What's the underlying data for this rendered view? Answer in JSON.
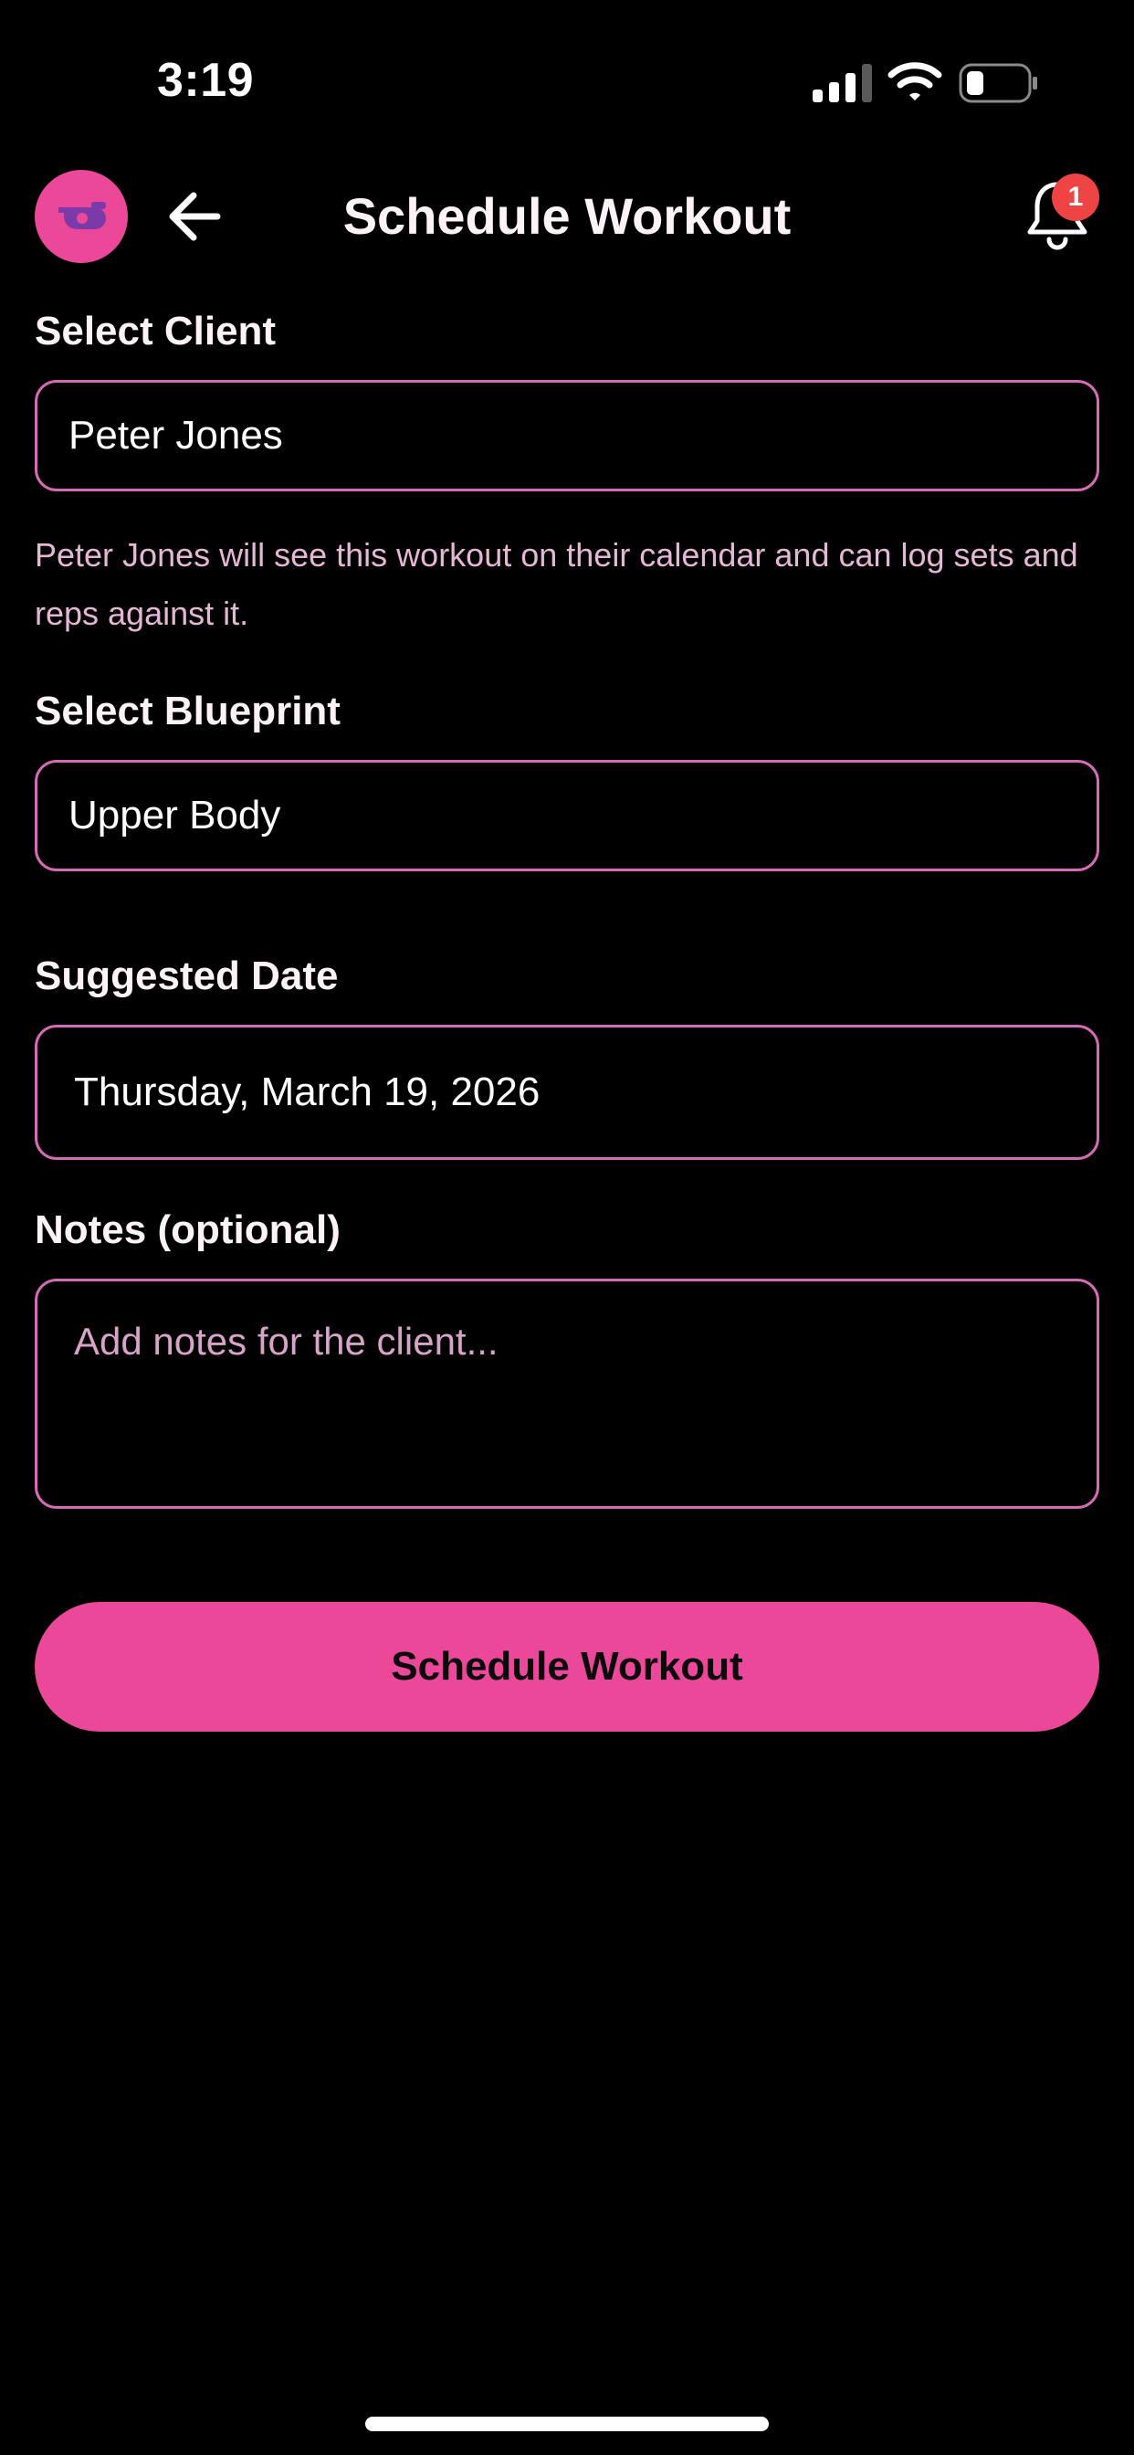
{
  "status_bar": {
    "time": "3:19",
    "icons": [
      "signal-icon",
      "wifi-icon",
      "battery-icon"
    ]
  },
  "header": {
    "logo_icon": "whistle-icon",
    "back_icon": "arrow-left-icon",
    "title": "Schedule Workout",
    "notification_icon": "bell-icon",
    "notification_count": "1"
  },
  "form": {
    "client": {
      "label": "Select Client",
      "value": "Peter Jones",
      "helper": "Peter Jones will see this workout on their calendar and can log sets and reps against it."
    },
    "blueprint": {
      "label": "Select Blueprint",
      "value": "Upper Body"
    },
    "date": {
      "label": "Suggested Date",
      "value": "Thursday, March 19, 2026"
    },
    "notes": {
      "label": "Notes (optional)",
      "placeholder": "Add notes for the client..."
    },
    "submit_label": "Schedule Workout"
  },
  "colors": {
    "accent": "#ec4899",
    "field_border": "#d46bb4",
    "badge": "#ef4444",
    "background": "#000000"
  }
}
